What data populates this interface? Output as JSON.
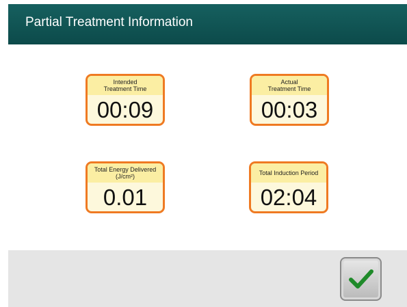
{
  "header": {
    "title": "Partial Treatment Information"
  },
  "tiles": [
    {
      "label_line1": "Intended",
      "label_line2": "Treatment Time",
      "value": "00:09"
    },
    {
      "label_line1": "Actual",
      "label_line2": "Treatment Time",
      "value": "00:03"
    },
    {
      "label_line1": "Total Energy Delivered",
      "label_line2": "(J/cm²)",
      "value": "0.01"
    },
    {
      "label_line1": "Total Induction Period",
      "label_line2": "",
      "value": "02:04"
    }
  ],
  "footer": {
    "confirm_icon": "checkmark-icon"
  },
  "colors": {
    "header": "#0c4a4a",
    "tile_border": "#ef7a22",
    "tile_label_bg": "#fbeea3",
    "check": "#1f8a2a"
  }
}
